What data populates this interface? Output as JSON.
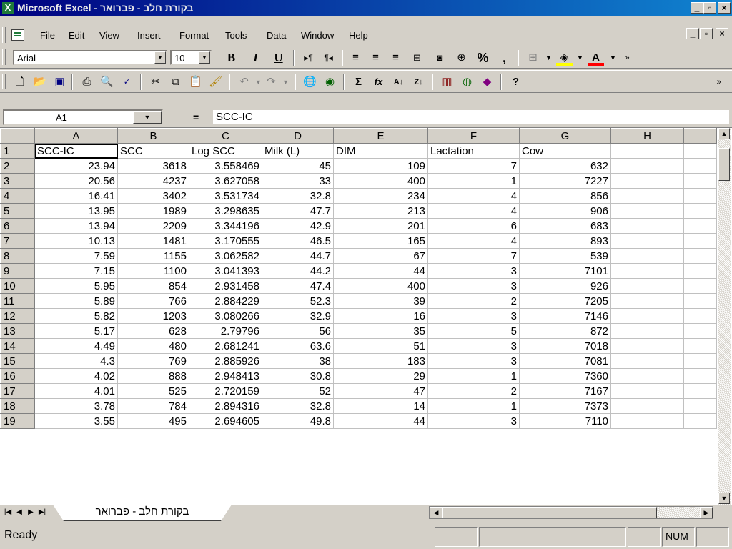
{
  "window": {
    "app_name": "Microsoft Excel",
    "title": "Microsoft Excel - בקורת חלב - פברואר",
    "controls": [
      "_",
      "▫",
      "×"
    ]
  },
  "menubar": {
    "items": [
      "File",
      "Edit",
      "View",
      "Insert",
      "Format",
      "Tools",
      "Data",
      "Window",
      "Help"
    ]
  },
  "formatting_toolbar": {
    "font": "Arial",
    "font_size": "10",
    "bold": "B",
    "italic": "I",
    "underline": "U",
    "currency": "%",
    "comma": ","
  },
  "formula_bar": {
    "name_box": "A1",
    "equals": "=",
    "content": "SCC-IC"
  },
  "grid": {
    "columns": [
      "A",
      "B",
      "C",
      "D",
      "E",
      "F",
      "G",
      "H"
    ],
    "rows": [
      {
        "n": "1",
        "cells": [
          "SCC-IC",
          "SCC",
          "Log SCC",
          "Milk (L)",
          "DIM",
          "Lactation",
          "Cow",
          ""
        ]
      },
      {
        "n": "2",
        "cells": [
          "23.94",
          "3618",
          "3.558469",
          "45",
          "109",
          "7",
          "632",
          ""
        ]
      },
      {
        "n": "3",
        "cells": [
          "20.56",
          "4237",
          "3.627058",
          "33",
          "400",
          "1",
          "7227",
          ""
        ]
      },
      {
        "n": "4",
        "cells": [
          "16.41",
          "3402",
          "3.531734",
          "32.8",
          "234",
          "4",
          "856",
          ""
        ]
      },
      {
        "n": "5",
        "cells": [
          "13.95",
          "1989",
          "3.298635",
          "47.7",
          "213",
          "4",
          "906",
          ""
        ]
      },
      {
        "n": "6",
        "cells": [
          "13.94",
          "2209",
          "3.344196",
          "42.9",
          "201",
          "6",
          "683",
          ""
        ]
      },
      {
        "n": "7",
        "cells": [
          "10.13",
          "1481",
          "3.170555",
          "46.5",
          "165",
          "4",
          "893",
          ""
        ]
      },
      {
        "n": "8",
        "cells": [
          "7.59",
          "1155",
          "3.062582",
          "44.7",
          "67",
          "7",
          "539",
          ""
        ]
      },
      {
        "n": "9",
        "cells": [
          "7.15",
          "1100",
          "3.041393",
          "44.2",
          "44",
          "3",
          "7101",
          ""
        ]
      },
      {
        "n": "10",
        "cells": [
          "5.95",
          "854",
          "2.931458",
          "47.4",
          "400",
          "3",
          "926",
          ""
        ]
      },
      {
        "n": "11",
        "cells": [
          "5.89",
          "766",
          "2.884229",
          "52.3",
          "39",
          "2",
          "7205",
          ""
        ]
      },
      {
        "n": "12",
        "cells": [
          "5.82",
          "1203",
          "3.080266",
          "32.9",
          "16",
          "3",
          "7146",
          ""
        ]
      },
      {
        "n": "13",
        "cells": [
          "5.17",
          "628",
          "2.79796",
          "56",
          "35",
          "5",
          "872",
          ""
        ]
      },
      {
        "n": "14",
        "cells": [
          "4.49",
          "480",
          "2.681241",
          "63.6",
          "51",
          "3",
          "7018",
          ""
        ]
      },
      {
        "n": "15",
        "cells": [
          "4.3",
          "769",
          "2.885926",
          "38",
          "183",
          "3",
          "7081",
          ""
        ]
      },
      {
        "n": "16",
        "cells": [
          "4.02",
          "888",
          "2.948413",
          "30.8",
          "29",
          "1",
          "7360",
          ""
        ]
      },
      {
        "n": "17",
        "cells": [
          "4.01",
          "525",
          "2.720159",
          "52",
          "47",
          "2",
          "7167",
          ""
        ]
      },
      {
        "n": "18",
        "cells": [
          "3.78",
          "784",
          "2.894316",
          "32.8",
          "14",
          "1",
          "7373",
          ""
        ]
      },
      {
        "n": "19",
        "cells": [
          "3.55",
          "495",
          "2.694605",
          "49.8",
          "44",
          "3",
          "7110",
          ""
        ]
      }
    ]
  },
  "sheet_tabs": {
    "active": "בקורת חלב - פברואר"
  },
  "statusbar": {
    "status": "Ready",
    "num_indicator": "NUM"
  },
  "colors": {
    "title_bar": "#000080",
    "face": "#d4d0c8"
  },
  "icons": [
    "excel-app-icon",
    "new-icon",
    "open-icon",
    "save-icon",
    "print-icon",
    "print-preview-icon",
    "spelling-icon",
    "cut-icon",
    "copy-icon",
    "paste-icon",
    "format-painter-icon",
    "undo-icon",
    "redo-icon",
    "hyperlink-icon",
    "web-icon",
    "autosum-icon",
    "function-icon",
    "sort-ascending-icon",
    "sort-descending-icon",
    "chart-wizard-icon",
    "map-icon",
    "drawing-icon",
    "help-icon"
  ]
}
